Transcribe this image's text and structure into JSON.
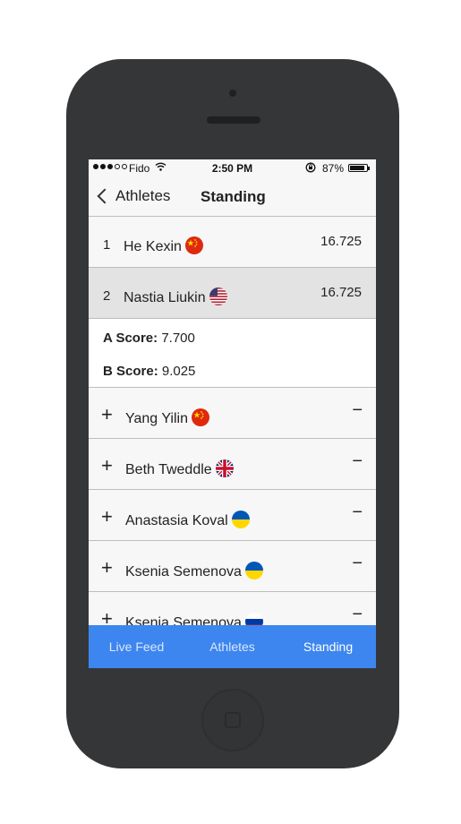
{
  "status_bar": {
    "carrier": "Fido",
    "time": "2:50 PM",
    "battery": "87%",
    "battery_level": 0.87,
    "icons": [
      "signal-dots-icon",
      "wifi-icon",
      "rotation-lock-icon",
      "battery-icon"
    ]
  },
  "nav": {
    "back_label": "Athletes",
    "title": "Standing"
  },
  "standings": [
    {
      "rank": "1",
      "name": "He Kexin",
      "flag": "china-flag-icon",
      "score": "16.725"
    },
    {
      "rank": "2",
      "name": "Nastia Liukin",
      "flag": "usa-flag-icon",
      "score": "16.725"
    }
  ],
  "expanded": {
    "a_label": "A Score:",
    "a_value": "7.700",
    "b_label": "B Score:",
    "b_value": "9.025"
  },
  "collapsed_rows": [
    {
      "expand": "+",
      "name": "Yang Yilin",
      "flag": "china-flag-icon",
      "collapse": "−"
    },
    {
      "expand": "+",
      "name": "Beth Tweddle",
      "flag": "uk-flag-icon",
      "collapse": "−"
    },
    {
      "expand": "+",
      "name": "Anastasia Koval",
      "flag": "ukraine-flag-icon",
      "collapse": "−"
    },
    {
      "expand": "+",
      "name": "Ksenia Semenova",
      "flag": "ukraine-flag-icon",
      "collapse": "−"
    },
    {
      "expand": "+",
      "name": "Ksenia Semenova",
      "flag": "russia-flag-icon",
      "collapse": "−"
    }
  ],
  "tabs": [
    {
      "label": "Live Feed",
      "active": false
    },
    {
      "label": "Athletes",
      "active": false
    },
    {
      "label": "Standing",
      "active": true
    }
  ],
  "colors": {
    "tab_bar": "#3d86ef",
    "selected_row": "#e3e3e3",
    "phone_body": "#353637"
  }
}
